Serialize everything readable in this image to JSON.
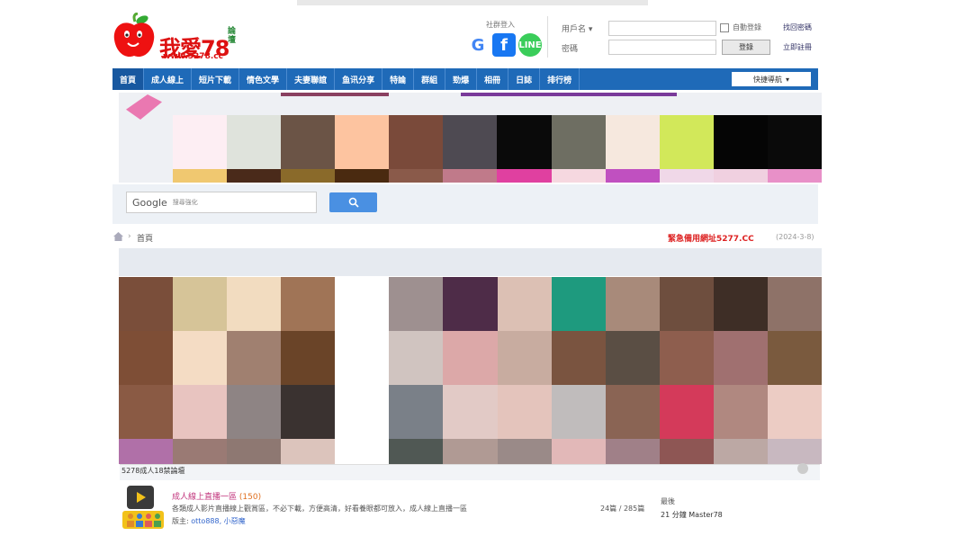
{
  "header": {
    "logo_text": "我愛78",
    "logo_sub": "論壇",
    "logo_url": "www.5278.cc",
    "social_label": "社群登入",
    "social_icons": [
      "google-icon",
      "facebook-icon",
      "line-icon"
    ],
    "social_glyphs": {
      "google": "G",
      "facebook": "f",
      "line": "LINE"
    },
    "username_label": "用戶名 ▾",
    "password_label": "密碼",
    "username_value": "",
    "password_value": "",
    "autologin_label": "自動登錄",
    "login_button": "登錄",
    "link_forgot": "找回密碼",
    "link_register": "立即註冊"
  },
  "nav": {
    "items": [
      "首頁",
      "成人線上",
      "短片下載",
      "情色文學",
      "夫妻聯誼",
      "鱼讯分享",
      "特論",
      "群組",
      "勁爆",
      "相冊",
      "日誌",
      "排行榜"
    ],
    "quick_nav": "快捷導航",
    "quick_nav_caret": "▾"
  },
  "search": {
    "brand": "Google",
    "placeholder": "搜尋強化",
    "button_icon": "search-icon",
    "button_glyph": "🔍"
  },
  "breadcrumb": {
    "home_icon": "home-icon",
    "separator": "›",
    "current": "首頁"
  },
  "notice": {
    "text": "緊急備用網址5277.CC",
    "date": "(2024-3-8)"
  },
  "section": {
    "title": "5278成人18禁論壇"
  },
  "forum": {
    "title": "成人線上直播一區",
    "count": "(150)",
    "description": "各類成人影片直播線上觀賞區，不必下載，方便高清，好看養眼都可放入，成人線上直播一區",
    "mods_label": "版主:",
    "mods": "otto888, 小惡魔",
    "stats": "24篇 / 285篇",
    "last_label": "最後",
    "last_post": "21 分鐘 Master78"
  },
  "colors": {
    "brand_red": "#dd1111",
    "nav_blue": "#1f6ab8",
    "accent_pink": "#c2367d",
    "notice_red": "#dd2222"
  }
}
